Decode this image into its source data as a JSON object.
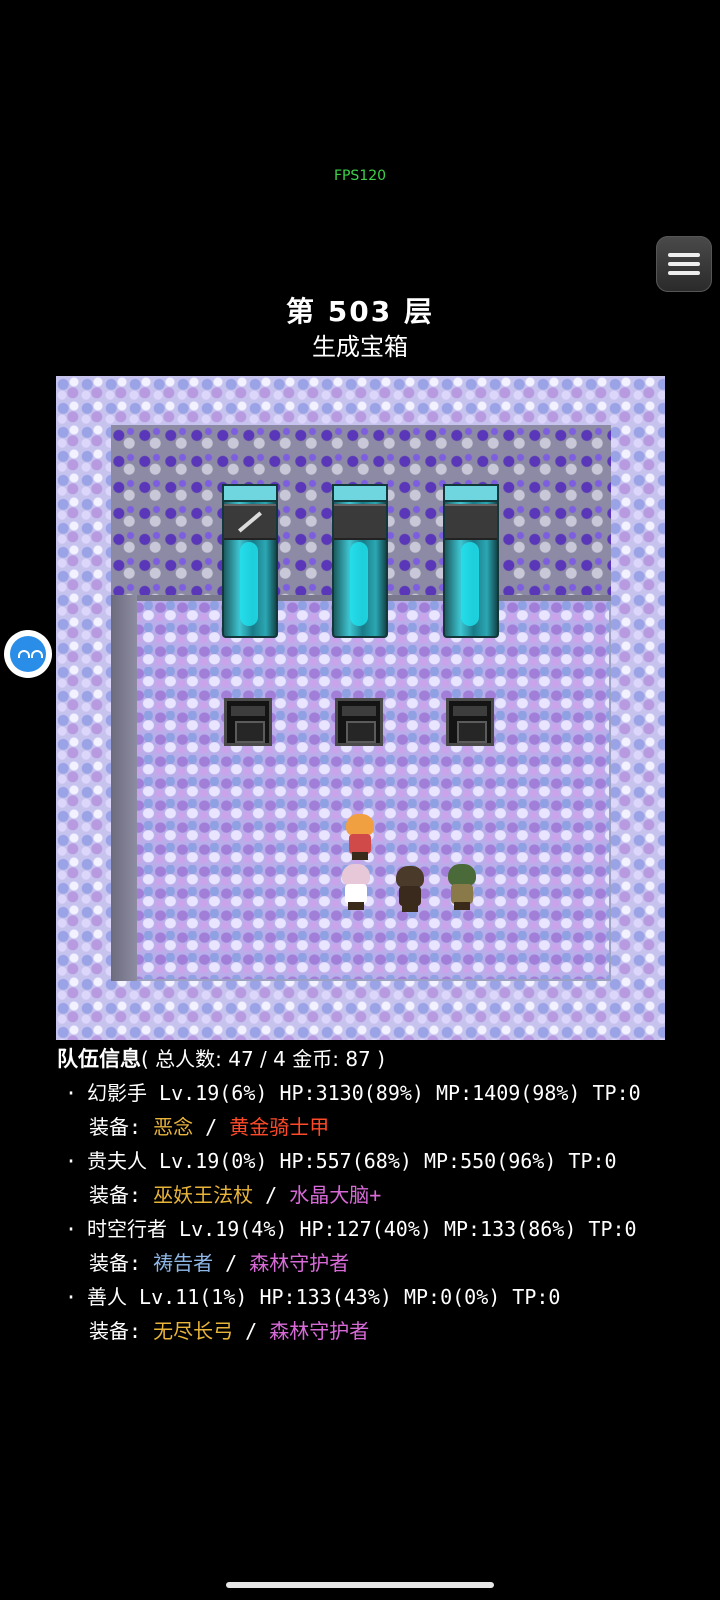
{
  "fps": "FPS120",
  "floor": {
    "title": "第 503 层",
    "subtitle": "生成宝箱"
  },
  "party": {
    "heading": "队伍信息",
    "summary": "( 总人数: 47 / 4 金币: 87 )",
    "equip_label": "装备:",
    "separator": "/",
    "members": [
      {
        "stats": "幻影手 Lv.19(6%) HP:3130(89%) MP:1409(98%) TP:0",
        "equip1": "恶念",
        "equip1_color": "#e8b43a",
        "equip2": "黄金骑士甲",
        "equip2_color": "#ff4a2a"
      },
      {
        "stats": "贵夫人 Lv.19(0%) HP:557(68%) MP:550(96%) TP:0",
        "equip1": "巫妖王法杖",
        "equip1_color": "#e8b43a",
        "equip2": "水晶大脑+",
        "equip2_color": "#d86ad8"
      },
      {
        "stats": "时空行者 Lv.19(4%) HP:127(40%) MP:133(86%) TP:0",
        "equip1": "祷告者",
        "equip1_color": "#8fb8e8",
        "equip2": "森林守护者",
        "equip2_color": "#d86ad8"
      },
      {
        "stats": "善人 Lv.11(1%) HP:133(43%) MP:0(0%) TP:0",
        "equip1": "无尽长弓",
        "equip1_color": "#e8b43a",
        "equip2": "森林守护者",
        "equip2_color": "#d86ad8"
      }
    ]
  },
  "icons": {
    "menu": "hamburger-icon",
    "side": "smile-face-icon",
    "sword": "sword-icon"
  }
}
